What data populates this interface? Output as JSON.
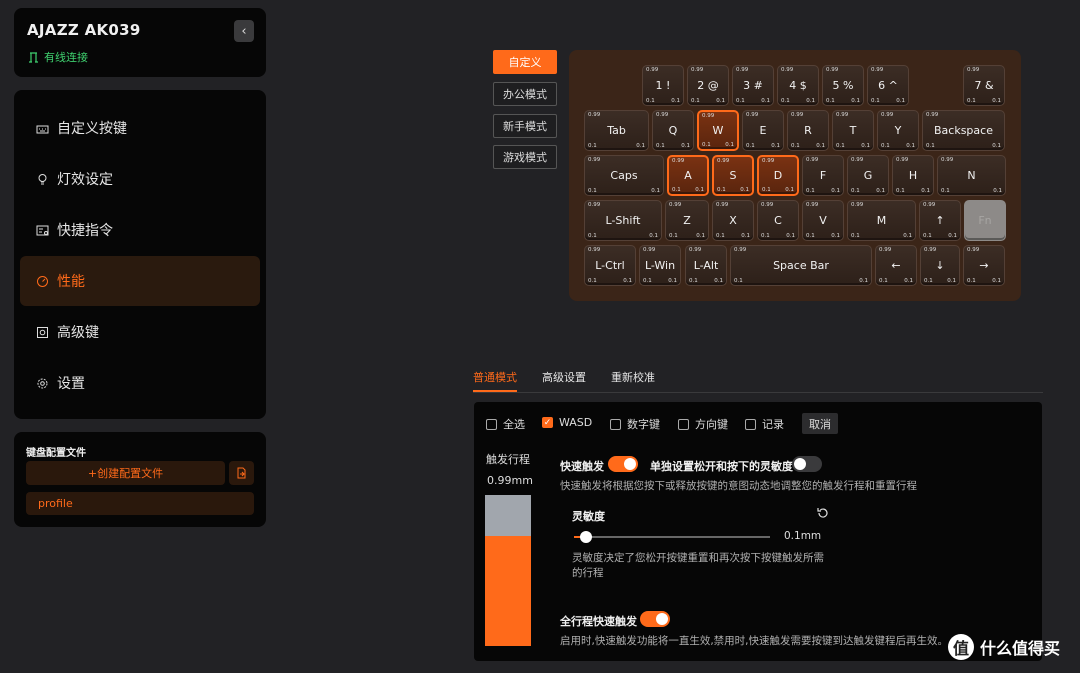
{
  "device": {
    "name": "AJAZZ AK039",
    "connection": "有线连接",
    "collapse_glyph": "‹"
  },
  "nav": {
    "items": [
      {
        "label": "自定义按键",
        "icon": "keyboard-icon"
      },
      {
        "label": "灯效设定",
        "icon": "bulb-icon"
      },
      {
        "label": "快捷指令",
        "icon": "command-icon"
      },
      {
        "label": "性能",
        "icon": "gauge-icon",
        "active": true
      },
      {
        "label": "高级键",
        "icon": "advanced-key-icon"
      },
      {
        "label": "设置",
        "icon": "gear-icon"
      }
    ]
  },
  "profiles": {
    "title": "键盘配置文件",
    "create_label": "+创建配置文件",
    "items": [
      "profile"
    ]
  },
  "modes": [
    "自定义",
    "办公模式",
    "新手模式",
    "游戏模式"
  ],
  "keyboard": {
    "rows": [
      [
        {
          "l": "1 !"
        },
        {
          "l": "2 @"
        },
        {
          "l": "3 #"
        },
        {
          "l": "4 $"
        },
        {
          "l": "5 %"
        },
        {
          "l": "6 ^"
        },
        {
          "l": "7 &"
        }
      ],
      [
        {
          "l": "Tab"
        },
        {
          "l": "Q"
        },
        {
          "l": "W"
        },
        {
          "l": "E"
        },
        {
          "l": "R"
        },
        {
          "l": "T"
        },
        {
          "l": "Y"
        },
        {
          "l": "Backspace"
        }
      ],
      [
        {
          "l": "Caps"
        },
        {
          "l": "A"
        },
        {
          "l": "S"
        },
        {
          "l": "D"
        },
        {
          "l": "F"
        },
        {
          "l": "G"
        },
        {
          "l": "H"
        },
        {
          "l": "N"
        }
      ],
      [
        {
          "l": "L-Shift"
        },
        {
          "l": "Z"
        },
        {
          "l": "X"
        },
        {
          "l": "C"
        },
        {
          "l": "V"
        },
        {
          "l": "M"
        },
        {
          "l": "↑"
        },
        {
          "l": "Fn"
        }
      ],
      [
        {
          "l": "L-Ctrl"
        },
        {
          "l": "L-Win"
        },
        {
          "l": "L-Alt"
        },
        {
          "l": "Space Bar"
        },
        {
          "l": "←"
        },
        {
          "l": "↓"
        },
        {
          "l": "→"
        }
      ]
    ],
    "selected_keys": [
      "W",
      "A",
      "S",
      "D"
    ],
    "actuation": "0.99",
    "release": "0.1",
    "press": "0.1"
  },
  "tabs": [
    "普通模式",
    "高级设置",
    "重新校准"
  ],
  "filters": {
    "items": [
      {
        "label": "全选",
        "checked": false
      },
      {
        "label": "WASD",
        "checked": true
      },
      {
        "label": "数字键",
        "checked": false
      },
      {
        "label": "方向键",
        "checked": false
      },
      {
        "label": "记录",
        "checked": false
      }
    ],
    "cancel_label": "取消"
  },
  "travel": {
    "label": "触发行程",
    "value": "0.99mm",
    "fill_fraction": 0.73
  },
  "rapid_trigger": {
    "label": "快速触发",
    "enabled": true,
    "separate_label": "单独设置松开和按下的灵敏度",
    "separate_enabled": false,
    "description": "快速触发将根据您按下或释放按键的意图动态地调整您的触发行程和重置行程",
    "sensitivity_label": "灵敏度",
    "sensitivity_value": "0.1mm",
    "sensitivity_fraction": 0.06,
    "sensitivity_desc_1": "灵敏度决定了您松开按键重置和再次按下按键触发所需",
    "sensitivity_desc_2": "的行程"
  },
  "full_travel": {
    "label": "全行程快速触发",
    "enabled": true,
    "description": "启用时,快速触发功能将一直生效,禁用时,快速触发需要按键到达触发键程后再生效。"
  },
  "watermark": {
    "text": "什么值得买",
    "logo": "值"
  },
  "colors": {
    "accent": "#ff6a1a",
    "connected": "#3fd16f",
    "keyboard_bg": "#3b2518"
  }
}
